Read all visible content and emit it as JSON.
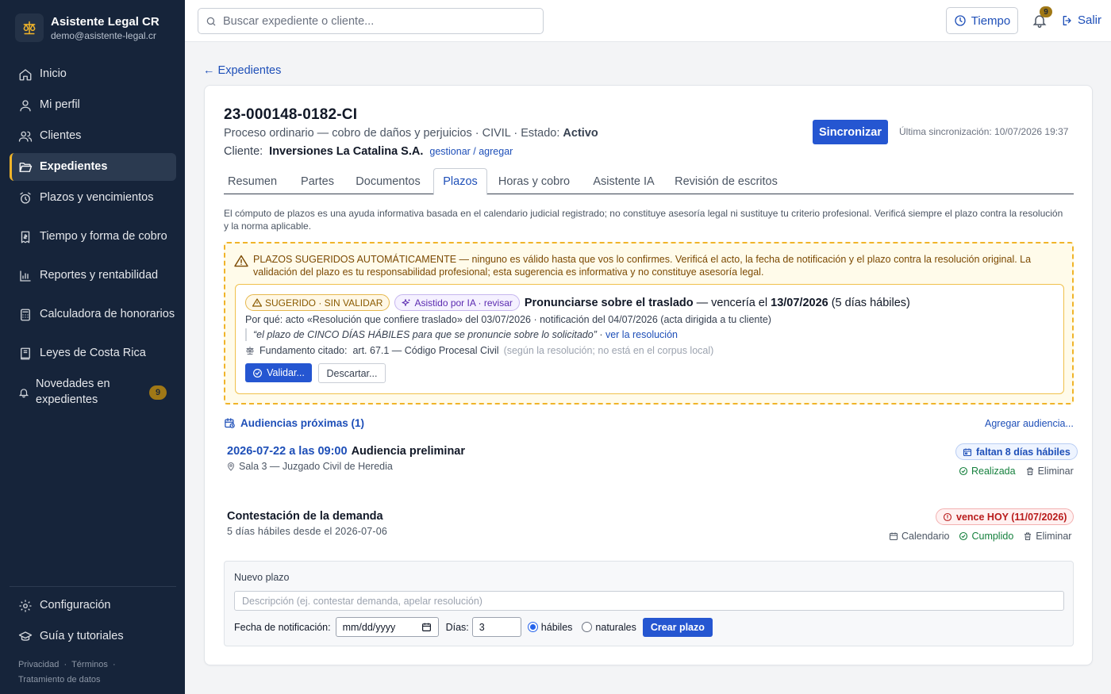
{
  "brand": {
    "title": "Asistente Legal CR",
    "email": "demo@asistente-legal.cr"
  },
  "sidebar": {
    "items": [
      {
        "label": "Inicio",
        "icon": "home-icon"
      },
      {
        "label": "Mi perfil",
        "icon": "user-icon"
      },
      {
        "label": "Clientes",
        "icon": "users-icon"
      },
      {
        "label": "Expedientes",
        "icon": "folder-open-icon",
        "active": true
      },
      {
        "label": "Plazos y vencimientos",
        "icon": "alarm-clock-icon"
      },
      {
        "label": "Tiempo y forma de cobro",
        "icon": "receipt-icon"
      },
      {
        "label": "Reportes y rentabilidad",
        "icon": "bar-chart-icon"
      },
      {
        "label": "Calculadora de honorarios",
        "icon": "calculator-icon"
      },
      {
        "label": "Leyes de Costa Rica",
        "icon": "book-icon"
      },
      {
        "label": "Novedades en expedientes",
        "icon": "bell-icon",
        "badge": "9"
      }
    ],
    "bottom": [
      {
        "label": "Configuración",
        "icon": "gear-icon"
      },
      {
        "label": "Guía y tutoriales",
        "icon": "graduation-cap-icon"
      }
    ],
    "legal": {
      "privacy": "Privacidad",
      "sep": "·",
      "terms": "Términos",
      "data": "Tratamiento de datos"
    }
  },
  "topbar": {
    "search_placeholder": "Buscar expediente o cliente...",
    "time_button": "Tiempo",
    "notifications_count": "9",
    "logout": "Salir"
  },
  "main": {
    "back": "← Expedientes",
    "case_number": "23-000148-0182-CI",
    "case_desc": "Proceso ordinario — cobro de daños y perjuicios · CIVIL · Estado: ",
    "case_status": "Activo",
    "client_label": "Cliente:",
    "client_name": "Inversiones La Catalina S.A.",
    "client_manage": "gestionar / agregar",
    "sync_button": "Sincronizar",
    "last_sync": "Última sincronización: 10/07/2026 19:37",
    "tabs": [
      "Resumen",
      "Partes",
      "Documentos",
      "Plazos",
      "Horas y cobro",
      "Asistente IA",
      "Revisión de escritos"
    ],
    "active_tab": "Plazos",
    "disclaimer": "El cómputo de plazos es una ayuda informativa basada en el calendario judicial registrado; no constituye asesoría legal ni sustituye tu criterio profesional. Verificá siempre el plazo contra la resolución y la norma aplicable."
  },
  "suggestions": {
    "warning": "PLAZOS SUGERIDOS AUTOMÁTICAMENTE — ninguno es válido hasta que vos lo confirmes. Verificá el acto, la fecha de notificación y el plazo contra la resolución original. La validación del plazo es tu responsabilidad profesional; esta sugerencia es informativa y no constituye asesoría legal.",
    "item": {
      "status_pill": "SUGERIDO · SIN VALIDAR",
      "ai_pill": "Asistido por IA · revisar",
      "title": "Pronunciarse sobre el traslado",
      "title_mid": " — vencería el ",
      "due_date": "13/07/2026",
      "due_extra": " (5 días hábiles)",
      "why": "Por qué: acto «Resolución que confiere traslado» del 03/07/2026 · notificación del 04/07/2026 (acta dirigida a tu cliente)",
      "quote": "“el plazo de CINCO DÍAS HÁBILES para que se pronuncie sobre lo solicitado”",
      "quote_sep": " · ",
      "quote_link": "ver la resolución",
      "basis_label": "Fundamento citado:",
      "basis_value": "art. 67.1 — Código Procesal Civil",
      "basis_note": "(según la resolución; no está en el corpus local)",
      "validate": "Validar...",
      "discard": "Descartar..."
    }
  },
  "hearings": {
    "header": "Audiencias próximas (1)",
    "add": "Agregar audiencia...",
    "items": [
      {
        "date": "2026-07-22 a las 09:00",
        "title": "Audiencia preliminar",
        "location": "Sala 3 — Juzgado Civil de Heredia",
        "pill": "faltan 8 días hábiles",
        "done": "Realizada",
        "delete": "Eliminar"
      }
    ]
  },
  "deadlines": {
    "items": [
      {
        "title": "Contestación de la demanda",
        "sub": "5 días hábiles desde el 2026-07-06",
        "pill": "vence HOY (11/07/2026)",
        "calendar": "Calendario",
        "done": "Cumplido",
        "delete": "Eliminar"
      }
    ]
  },
  "new_deadline": {
    "title": "Nuevo plazo",
    "desc_placeholder": "Descripción (ej. contestar demanda, apelar resolución)",
    "date_label": "Fecha de notificación:",
    "date_value": "mm/dd/yyyy",
    "days_label": "Días:",
    "days_value": "3",
    "opt_business": "hábiles",
    "opt_natural": "naturales",
    "create": "Crear plazo"
  },
  "colors": {
    "sidebar": "#16243a",
    "accent": "#2556d1",
    "warning": "#f0b429",
    "danger": "#b91c1c",
    "success": "#15803d"
  }
}
